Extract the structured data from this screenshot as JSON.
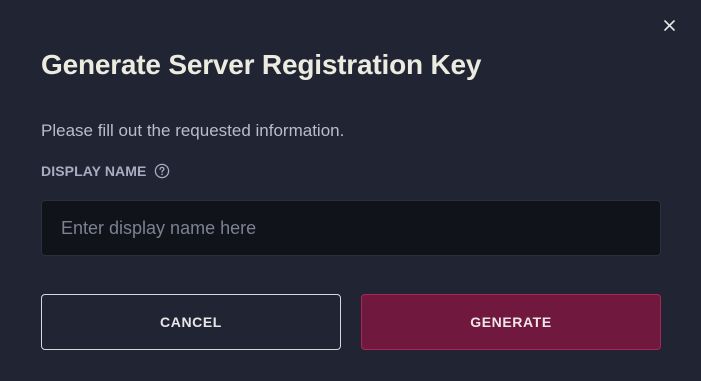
{
  "dialog": {
    "title": "Generate Server Registration Key",
    "subtitle": "Please fill out the requested information.",
    "close_icon": "close-icon"
  },
  "form": {
    "display_name_label": "DISPLAY NAME",
    "help_icon": "question-circle-icon",
    "display_name_value": "",
    "display_name_placeholder": "Enter display name here"
  },
  "actions": {
    "cancel_label": "CANCEL",
    "generate_label": "GENERATE"
  },
  "colors": {
    "background": "#212433",
    "input_background": "#11131b",
    "primary_button": "#70183d",
    "primary_button_border": "#b0235a",
    "title_text": "#ebebe0"
  }
}
